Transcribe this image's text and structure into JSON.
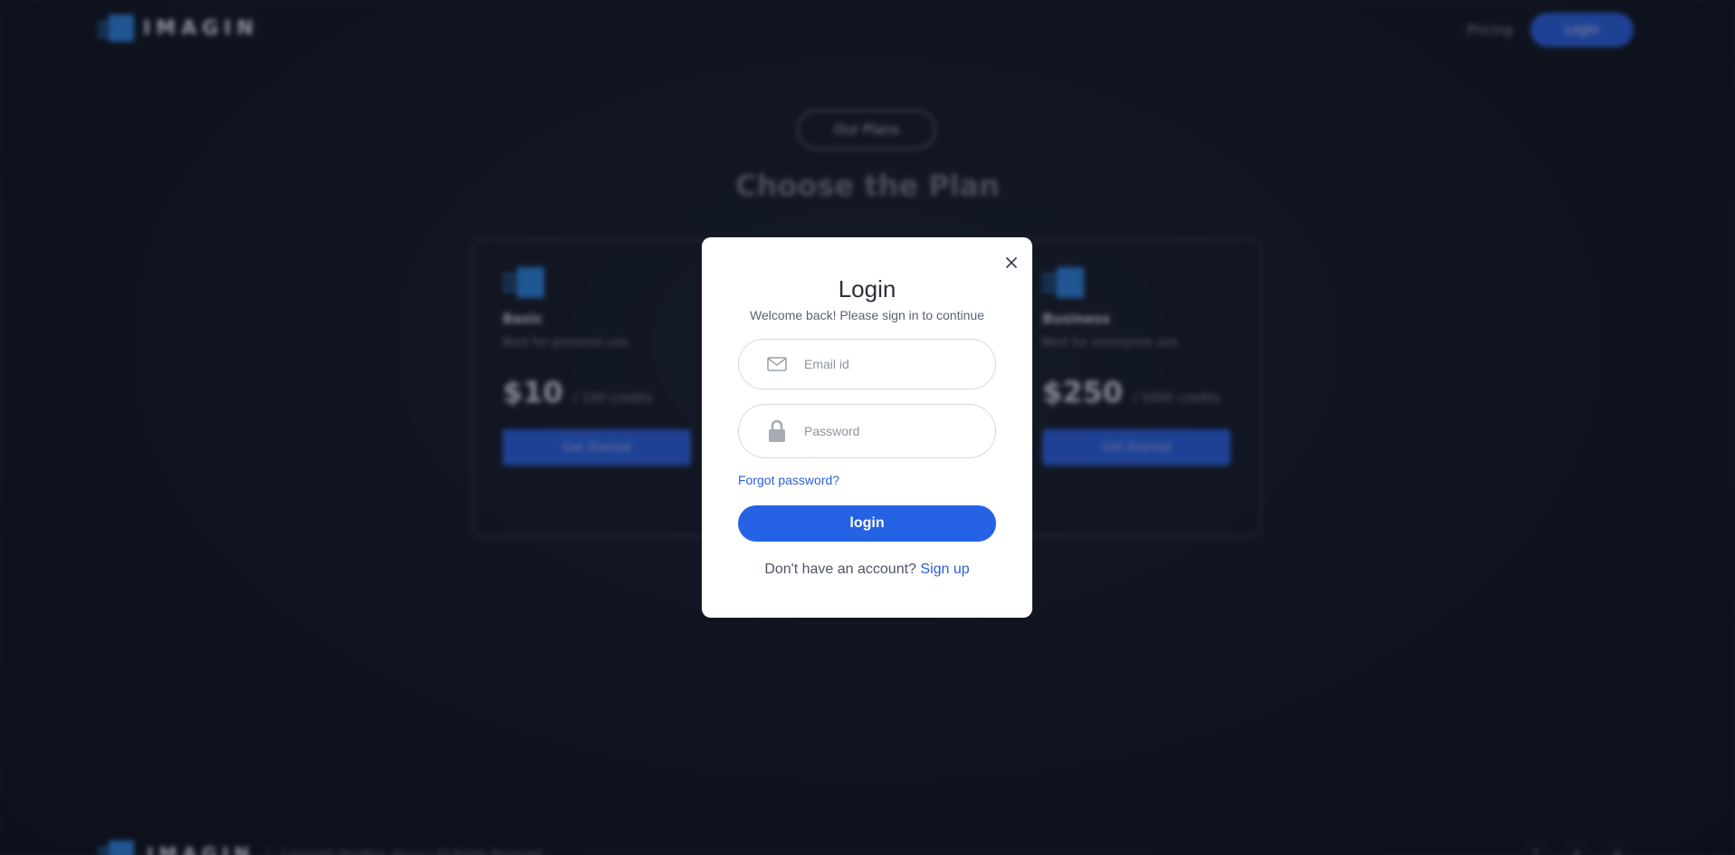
{
  "header": {
    "brand": "IMAGIN",
    "nav_pricing": "Pricing",
    "nav_login": "Login"
  },
  "plans": {
    "pill": "Our Plans",
    "title": "Choose the Plan",
    "items": [
      {
        "name": "Basic",
        "desc": "Best for personal use.",
        "price": "$10",
        "per": "/ 100 credits",
        "cta": "Get Started"
      },
      {
        "name": "Business",
        "desc": "Best for enterprise use.",
        "price": "$250",
        "per": "/ 5000 credits",
        "cta": "Get Started"
      }
    ]
  },
  "footer": {
    "brand": "IMAGIN",
    "copyright": "Copyright @rodbox_dev.ru | All Rights Reserved.",
    "social_icons": [
      "facebook-icon",
      "twitter-icon",
      "instagram-icon"
    ]
  },
  "modal": {
    "title": "Login",
    "subtitle": "Welcome back! Please sign in to continue",
    "email_placeholder": "Email id",
    "password_placeholder": "Password",
    "forgot": "Forgot password?",
    "submit": "login",
    "no_account": "Don't have an account?",
    "signup": "Sign up",
    "icons": {
      "close": "close-icon",
      "email": "mail-icon",
      "password": "lock-icon"
    }
  },
  "colors": {
    "accent": "#2562e4",
    "link": "#2b5fd9",
    "background": "#1a1f2d",
    "modal_bg": "#ffffff"
  }
}
